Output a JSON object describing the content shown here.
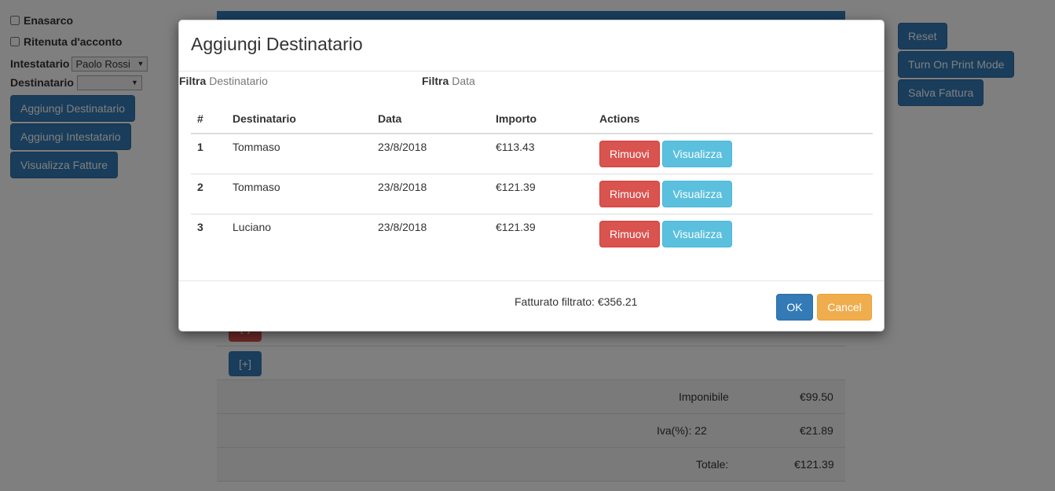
{
  "left": {
    "enasarco_label": "Enasarco",
    "ritenuta_label": "Ritenuta d'acconto",
    "intestatario_label": "Intestatario",
    "intestatario_value": "Paolo Rossi",
    "destinatario_label": "Destinatario",
    "destinatario_value": "",
    "buttons": [
      "Aggiungi Destinatario",
      "Aggiungi Intestatario",
      "Visualizza Fatture"
    ]
  },
  "right": {
    "buttons": [
      "Reset",
      "Turn On Print Mode",
      "Salva Fattura"
    ]
  },
  "background_table": {
    "remove_label": "[-]",
    "add_label": "[+]",
    "imponibile_label": "Imponibile",
    "imponibile_value": "€99.50",
    "iva_label": "Iva(%): 22",
    "iva_value": "€21.89",
    "totale_label": "Totale:",
    "totale_value": "€121.39"
  },
  "modal": {
    "title": "Aggiungi Destinatario",
    "filter1_label": "Filtra",
    "filter1_placeholder": "Destinatario",
    "filter2_label": "Filtra",
    "filter2_placeholder": "Data",
    "columns": [
      "#",
      "Destinatario",
      "Data",
      "Importo",
      "Actions"
    ],
    "rows": [
      {
        "num": "1",
        "destinatario": "Tommaso",
        "data": "23/8/2018",
        "importo": "€113.43"
      },
      {
        "num": "2",
        "destinatario": "Tommaso",
        "data": "23/8/2018",
        "importo": "€121.39"
      },
      {
        "num": "3",
        "destinatario": "Luciano",
        "data": "23/8/2018",
        "importo": "€121.39"
      }
    ],
    "remove_label": "Rimuovi",
    "view_label": "Visualizza",
    "fatturato": "Fatturato filtrato: €356.21",
    "ok_label": "OK",
    "cancel_label": "Cancel"
  },
  "colors": {
    "primary": "#337ab7",
    "danger": "#d9534f",
    "info": "#5bc0de",
    "warning": "#f0ad4e"
  }
}
